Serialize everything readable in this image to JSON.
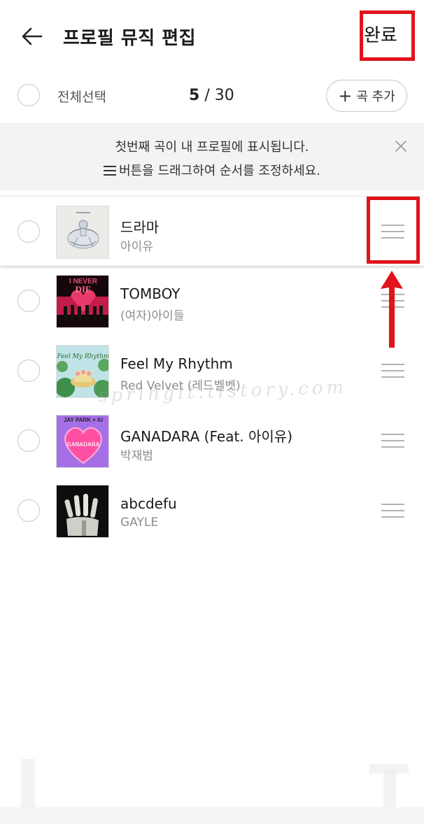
{
  "header": {
    "title": "프로필 뮤직 편집",
    "done_label": "완료"
  },
  "toolbar": {
    "select_all_label": "전체선택",
    "selected_count": "5",
    "separator": "/",
    "max_count": "30",
    "add_song_label": "곡 추가"
  },
  "notice": {
    "line1": "첫번째 곡이 내 프로필에 표시됩니다.",
    "line2": "버튼을 드래그하여 순서를 조정하세요."
  },
  "songs": [
    {
      "title": "드라마",
      "artist": "아이유"
    },
    {
      "title": "TOMBOY",
      "artist": "(여자)아이들"
    },
    {
      "title": "Feel My Rhythm",
      "artist": "Red Velvet (레드벨벳)"
    },
    {
      "title": "GANADARA (Feat. 아이유)",
      "artist": "박재범"
    },
    {
      "title": "abcdefu",
      "artist": "GAYLE"
    }
  ],
  "album_labels": {
    "tomboy_top": "I NEVER",
    "tomboy_die": "DIE",
    "ganadara_top": "JAY PARK × IU",
    "ganadara_art": "GANADARA",
    "rhythm_art": "Feel My Rhythm"
  },
  "watermark": "springit.tistory.com",
  "colors": {
    "highlight": "#e0141c",
    "notice_bg": "#f3f3f3",
    "circle_border": "#c8c8c8",
    "artist_text": "#8c8c8c"
  }
}
